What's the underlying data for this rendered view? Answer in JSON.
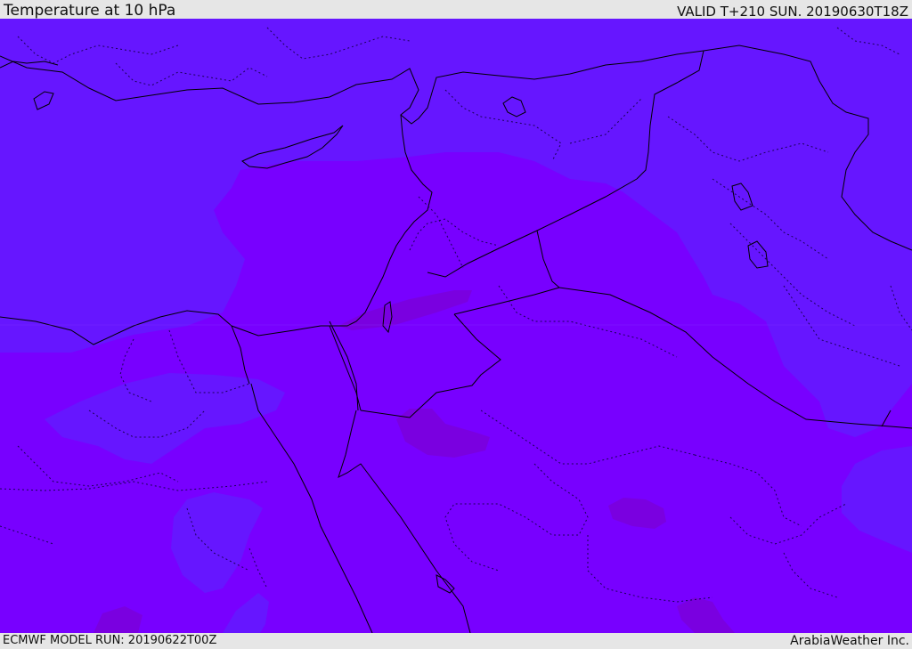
{
  "header": {
    "title": "Temperature at 10 hPa",
    "valid_time": "VALID T+210 SUN. 20190630T18Z"
  },
  "footer": {
    "model_run": "ECMWF MODEL RUN: 20190622T00Z",
    "credit": "ArabiaWeather Inc."
  },
  "colors": {
    "cold_band": "#6616ff",
    "mid_band": "#7800ff",
    "warm_band": "#7a00e0",
    "coastline": "#000000",
    "panel_bg": "#e6e6e6"
  }
}
